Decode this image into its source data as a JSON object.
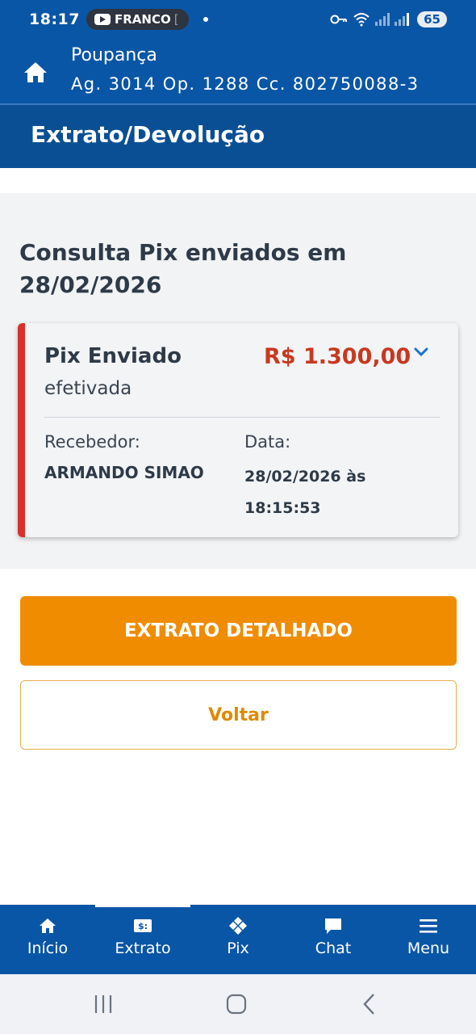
{
  "status_bar": {
    "time": "18:17",
    "notification_label": "FRANCO",
    "notification_suffix": "[",
    "battery": "65",
    "key_icon": "key-icon",
    "wifi_icon": "wifi-icon"
  },
  "account": {
    "type": "Poupança",
    "details": "Ag. 3014  Op. 1288  Cc. 802750088-3"
  },
  "page": {
    "title": "Extrato/Devolução"
  },
  "query": {
    "heading": "Consulta Pix enviados em 28/02/2026"
  },
  "transaction": {
    "type": "Pix Enviado",
    "status": "efetivada",
    "amount": "R$ 1.300,00",
    "receiver_label": "Recebedor:",
    "receiver_name": "ARMANDO SIMAO",
    "date_label": "Data:",
    "date_value": "28/02/2026 às 18:15:53"
  },
  "buttons": {
    "detailed": "EXTRATO DETALHADO",
    "back": "Voltar"
  },
  "bottom_nav": {
    "items": [
      {
        "label": "Início",
        "icon": "home-icon"
      },
      {
        "label": "Extrato",
        "icon": "statement-icon"
      },
      {
        "label": "Pix",
        "icon": "pix-icon"
      },
      {
        "label": "Chat",
        "icon": "chat-icon"
      },
      {
        "label": "Menu",
        "icon": "menu-icon"
      }
    ],
    "active_index": 1
  },
  "colors": {
    "primary_blue": "#0a56a6",
    "title_blue": "#0a4f94",
    "accent_orange": "#f08c00",
    "amount_red": "#c8391f",
    "card_accent_red": "#d6322b"
  }
}
